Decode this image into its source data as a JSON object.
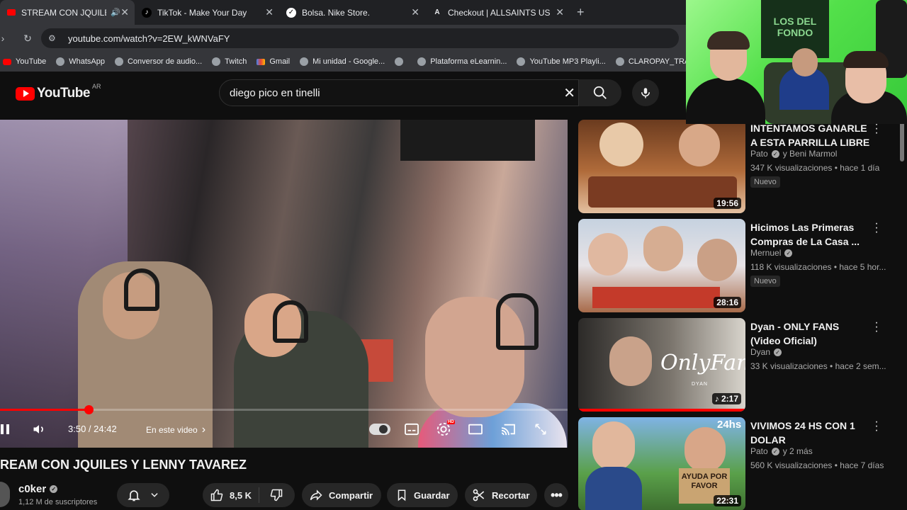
{
  "browser": {
    "tabs": [
      {
        "title": "STREAM CON JQUILES Y LE",
        "fav": "youtube-icon",
        "active": true
      },
      {
        "title": "TikTok - Make Your Day",
        "fav": "tiktok-icon",
        "active": false
      },
      {
        "title": "Bolsa. Nike Store.",
        "fav": "nike-icon",
        "active": false
      },
      {
        "title": "Checkout | ALLSAINTS US",
        "fav": "allsaints-icon",
        "active": false
      }
    ],
    "close_glyph": "✕",
    "new_tab_glyph": "+",
    "url": "youtube.com/watch?v=2EW_kWNVaFY",
    "bookmarks": [
      "YouTube",
      "WhatsApp",
      "Conversor de audio...",
      "Twitch",
      "Gmail",
      "Mi unidad - Google...",
      "",
      "Plataforma eLearnin...",
      "YouTube MP3 Playli...",
      "CLAROPAY_TRANSF..."
    ]
  },
  "youtube": {
    "logo_text": "YouTube",
    "country_code": "AR",
    "search_query": "diego pico en tinelli",
    "clear_glyph": "✕"
  },
  "player": {
    "progress_fraction": 0.1565,
    "time": "3:50 / 24:42",
    "chapters_label": "En este video",
    "chapters_arrow": "›"
  },
  "video": {
    "title": "REAM CON JQUILES Y LENNY TAVAREZ",
    "channel": "c0ker",
    "subscribers": "1,12 M de suscriptores",
    "like_count": "8,5 K",
    "share_label": "Compartir",
    "save_label": "Guardar",
    "clip_label": "Recortar"
  },
  "sidebar": {
    "items": [
      {
        "title": "INTENTAMOS GANARLE A ESTA PARRILLA LIBRE",
        "channel": "Pato",
        "channel_extra": "y Beni Marmol",
        "meta": "347 K visualizaciones • hace 1 día",
        "badge": "Nuevo",
        "duration": "19:56",
        "thumb_colors": [
          "#6b3b1f",
          "#b06b3a",
          "#e4c0a0"
        ]
      },
      {
        "title": "Hicimos Las Primeras Compras de La Casa ...",
        "channel": "Mernuel",
        "channel_extra": "",
        "meta": "118 K visualizaciones • hace 5 hor...",
        "badge": "Nuevo",
        "duration": "28:16",
        "thumb_colors": [
          "#c6d2e0",
          "#e7e3e6",
          "#a86b4a"
        ]
      },
      {
        "title": "Dyan - ONLY FANS (Video Oficial)",
        "channel": "Dyan",
        "channel_extra": "",
        "meta": "33 K visualizaciones • hace 2 sem...",
        "badge": "",
        "duration": "♪ 2:17",
        "thumb_colors": [
          "#2c2a28",
          "#7a746c",
          "#d8d4cc"
        ],
        "overlay_text": "OnlyFans",
        "overlay_sub": "DYAN",
        "watched": true
      },
      {
        "title": "VIVIMOS 24 HS CON 1 DOLAR",
        "channel": "Pato",
        "channel_extra": "y 2 más",
        "meta": "560 K visualizaciones • hace 7 días",
        "badge": "",
        "duration": "22:31",
        "thumb_colors": [
          "#7fb3e5",
          "#5aa04a",
          "#3d6e2f"
        ],
        "overlay_text": "24hs",
        "sign_text": "AYUDA POR FAVOR"
      }
    ]
  },
  "webcam": {
    "banner_text": "LOS DEL FONDO"
  },
  "colors": {
    "accent": "#ff0000",
    "background": "#0f0f0f",
    "secondary_text": "#aaaaaa",
    "webcam_green": "#53e04a"
  }
}
